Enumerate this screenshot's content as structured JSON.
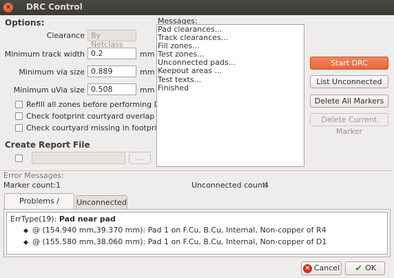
{
  "window": {
    "title": "DRC Control",
    "close_glyph": "×"
  },
  "options": {
    "heading": "Options:",
    "clearance_label": "Clearance",
    "clearance_value": "By Netclass",
    "min_track_width_label": "Minimum track width",
    "min_track_width_value": "0.2",
    "min_via_size_label": "Minimum via size",
    "min_via_size_value": "0.889",
    "min_uvia_size_label": "Minimum uVia size",
    "min_uvia_size_value": "0.508",
    "unit": "mm",
    "checkboxes": [
      {
        "label": "Refill all zones before performing DRC",
        "checked": false
      },
      {
        "label": "Check footprint courtyard overlap",
        "checked": false
      },
      {
        "label": "Check courtyard missing in footprints",
        "checked": false
      }
    ]
  },
  "report": {
    "heading": "Create Report File",
    "file_value": "",
    "browse_label": "..."
  },
  "messages": {
    "label": "Messages:",
    "lines": [
      "Pad clearances...",
      "Track clearances...",
      "Fill zones...",
      "Test zones...",
      "Unconnected pads...",
      "Keepout areas ...",
      "Test texts...",
      "Finished"
    ]
  },
  "actions": {
    "start_drc": "Start DRC",
    "list_unconnected": "List Unconnected",
    "delete_all_markers": "Delete All Markers",
    "delete_current_marker": "Delete Current Marker"
  },
  "errors": {
    "label": "Error Messages:",
    "marker_count_label": "Marker count:",
    "marker_count": "1",
    "unconnected_count_label": "Unconnected count:",
    "unconnected_count": "4",
    "tabs": [
      {
        "label": "Problems / Markers",
        "active": true
      },
      {
        "label": "Unconnected",
        "active": false
      }
    ],
    "problem": {
      "type": "ErrType(19):",
      "title": "Pad near pad",
      "items": [
        "@ (154.940 mm,39.370 mm): Pad 1 on F.Cu, B.Cu, Internal, Non-copper of R4",
        "@ (155.580 mm,38.060 mm): Pad 1 on F.Cu, B.Cu, Internal, Non-copper of D1"
      ]
    }
  },
  "footer": {
    "cancel": "Cancel",
    "ok": "OK",
    "cancel_icon": "×",
    "ok_icon": "✔"
  }
}
